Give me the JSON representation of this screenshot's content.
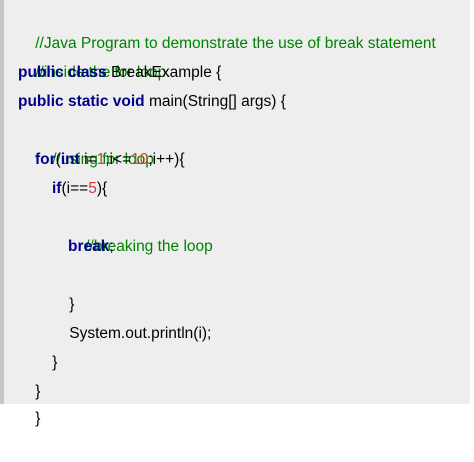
{
  "code": {
    "line1": {
      "comment": "//Java Program to demonstrate the use of break statement"
    },
    "line2": {
      "comment": "//inside the for loop."
    },
    "line3": {
      "kw1": "public",
      "kw2": "class",
      "text": " BreakExample {"
    },
    "line4": {
      "kw1": "public",
      "kw2": "static",
      "kw3": "void",
      "text": " main(String[] args) {"
    },
    "line5": {
      "comment": "//using for loop"
    },
    "line6": {
      "kw1": "for",
      "t1": "(",
      "kw2": "int",
      "t2": " i=",
      "n1": "1",
      "t3": ";i<=",
      "n2": "10",
      "t4": ";i++){"
    },
    "line7": {
      "kw1": "if",
      "t1": "(i==",
      "n1": "5",
      "t2": "){"
    },
    "line8": {
      "comment": "//breaking the loop"
    },
    "line9": {
      "kw1": "break",
      "t1": ";"
    },
    "line10": {
      "text": "}"
    },
    "line11": {
      "text": "System.out.println(i);"
    },
    "line12": {
      "text": "}"
    },
    "line13": {
      "text": "}"
    },
    "line14": {
      "text": "}"
    }
  },
  "colors": {
    "keyword": "#00008b",
    "comment": "#008200",
    "number": "#d63a3a",
    "background": "#eeeeee",
    "left_border": "#c6c6c6"
  }
}
